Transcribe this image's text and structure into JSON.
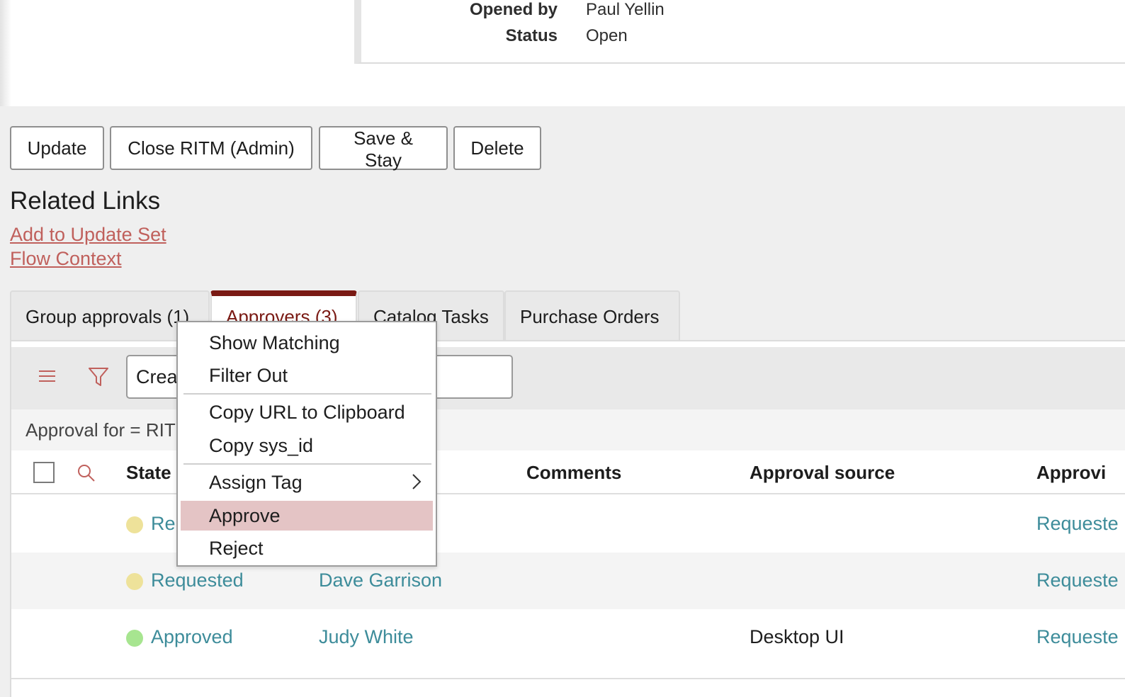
{
  "form": {
    "fields": [
      {
        "label": "Opened by",
        "value": "Paul Yellin"
      },
      {
        "label": "Status",
        "value": "Open"
      }
    ]
  },
  "buttons": {
    "update": "Update",
    "close_ritm": "Close RITM (Admin)",
    "save_stay": "Save & Stay",
    "delete": "Delete"
  },
  "related_links": {
    "title": "Related Links",
    "items": [
      "Add to Update Set",
      "Flow Context"
    ]
  },
  "tabs": [
    {
      "label": "Group approvals (1)",
      "active": false
    },
    {
      "label": "Approvers (3)",
      "active": true
    },
    {
      "label": "Catalog Tasks",
      "active": false
    },
    {
      "label": "Purchase Orders",
      "active": false
    }
  ],
  "toolbar": {
    "search_value": "Crea",
    "menu_icon": "hamburger-icon",
    "filter_icon": "funnel-icon"
  },
  "breadcrumb": "Approval for = RIT",
  "table": {
    "columns": [
      "State",
      "Comments",
      "Approval source",
      "Approvi"
    ],
    "rows": [
      {
        "state": "Re",
        "state_color": "#eee29a",
        "approver": "",
        "source": "",
        "approving": "Requeste"
      },
      {
        "state": "Requested",
        "state_color": "#eee29a",
        "approver": "Dave Garrison",
        "source": "",
        "approving": "Requeste"
      },
      {
        "state": "Approved",
        "state_color": "#a7e590",
        "approver": "Judy White",
        "source": "Desktop UI",
        "approving": "Requeste"
      }
    ]
  },
  "context_menu": {
    "items": [
      "Show Matching",
      "Filter Out",
      "Copy URL to Clipboard",
      "Copy sys_id",
      "Assign Tag",
      "Approve",
      "Reject"
    ],
    "highlighted": "Approve"
  },
  "colors": {
    "link": "#c0605c",
    "accent_tab": "#7a1a14",
    "table_link": "#3d8c9a",
    "highlight": "#e4c4c5"
  }
}
